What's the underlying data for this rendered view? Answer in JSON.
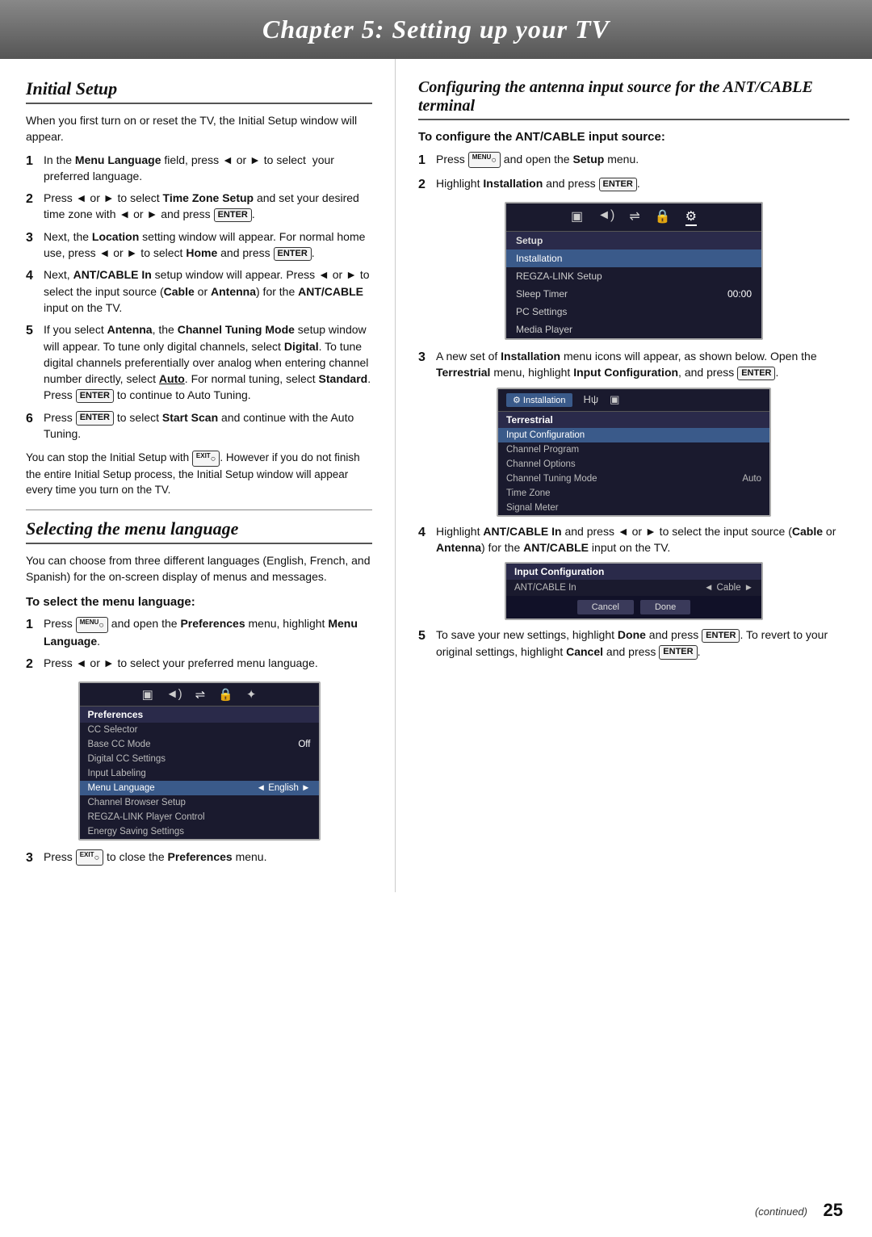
{
  "header": {
    "title": "Chapter 5: Setting up your TV"
  },
  "left": {
    "initial_setup": {
      "title": "Initial Setup",
      "intro": "When you first turn on or reset the TV, the Initial Setup window will appear.",
      "steps": [
        {
          "num": "1",
          "text": "In the ",
          "bold1": "Menu Language",
          "mid1": " field, press ◄ or ► to select  your preferred language."
        },
        {
          "num": "2",
          "text": "Press ◄ or ► to select ",
          "bold1": "Time Zone Setup",
          "mid1": " and set your desired time zone with ◄ or ► and press ",
          "key1": "ENTER"
        },
        {
          "num": "3",
          "text": "Next, the ",
          "bold1": "Location",
          "mid1": " setting window will appear. For normal home use, press ◄ or ► to select ",
          "bold2": "Home",
          "mid2": " and press ",
          "key1": "ENTER"
        },
        {
          "num": "4",
          "text": "Next, ",
          "bold1": "ANT/CABLE In",
          "mid1": " setup window will appear. Press ◄ or ► to select the input source (",
          "bold2": "Cable",
          "mid2": " or ",
          "bold3": "Antenna",
          "mid3": ") for the ",
          "bold4": "ANT/CABLE",
          "mid4": " input on the TV."
        },
        {
          "num": "5",
          "text": "If you select ",
          "bold1": "Antenna",
          "mid1": ", the ",
          "bold2": "Channel Tuning Mode",
          "mid2": " setup window will appear. To tune only digital channels, select ",
          "bold3": "Digital",
          "mid3": ". To tune digital channels preferentially over analog when entering channel number directly, select ",
          "bold4": "Auto",
          "mid4": ". For normal tuning, select ",
          "bold5": "Standard",
          "mid5": ". Press ",
          "key1": "ENTER",
          "mid6": " to continue to Auto Tuning."
        },
        {
          "num": "6",
          "text": "Press ",
          "key1": "ENTER",
          "mid1": " to select ",
          "bold1": "Start Scan",
          "mid2": " and continue with the Auto Tuning."
        }
      ],
      "note": "You can stop the Initial Setup with EXIT. However if you do not finish the entire Initial Setup process, the Initial Setup window will appear every time you turn on the TV."
    },
    "selecting_menu": {
      "title": "Selecting the menu language",
      "intro": "You can choose from three different languages (English, French, and Spanish) for the on-screen display of menus and messages.",
      "subsection": "To select the menu language:",
      "steps": [
        {
          "num": "1",
          "text": "Press ",
          "key1": "MENU",
          "mid1": " and open the ",
          "bold1": "Preferences",
          "mid2": " menu, highlight ",
          "bold2": "Menu Language",
          "mid3": "."
        },
        {
          "num": "2",
          "text": "Press ◄ or ► to select your preferred menu language."
        },
        {
          "num": "3",
          "text": "Press ",
          "key1": "EXIT",
          "mid1": " to close the ",
          "bold1": "Preferences",
          "mid2": " menu."
        }
      ]
    }
  },
  "right": {
    "configuring": {
      "title": "Configuring the antenna input source for the ANT/CABLE terminal",
      "subsection": "To configure the ANT/CABLE input source:",
      "steps": [
        {
          "num": "1",
          "text": "Press ",
          "key1": "MENU",
          "mid1": " and open the ",
          "bold1": "Setup",
          "mid2": " menu."
        },
        {
          "num": "2",
          "text": "Highlight ",
          "bold1": "Installation",
          "mid1": " and press ",
          "key1": "ENTER",
          "mid2": "."
        },
        {
          "num": "3",
          "text": "A new set of ",
          "bold1": "Installation",
          "mid1": " menu icons will appear, as shown below. Open the ",
          "bold2": "Terrestrial",
          "mid2": " menu, highlight ",
          "bold3": "Input Configuration",
          "mid3": ", and press ",
          "key1": "ENTER",
          "mid4": "."
        },
        {
          "num": "4",
          "text": "Highlight ",
          "bold1": "ANT/CABLE In",
          "mid1": " and press ◄ or ► to select the input source (",
          "bold2": "Cable",
          "mid2": " or ",
          "bold3": "Antenna",
          "mid3": ") for the ",
          "bold4": "ANT/CABLE",
          "mid4": " input on the TV."
        },
        {
          "num": "5",
          "text": "To save your new settings, highlight ",
          "bold1": "Done",
          "mid1": " and press ",
          "key1": "ENTER",
          "mid2": ". To revert to your original settings, highlight ",
          "bold2": "Cancel",
          "mid2b": " and press ",
          "key2": "ENTER",
          "mid3": "."
        }
      ]
    }
  },
  "setup_screen": {
    "menu_items": [
      "▣",
      "♪",
      "⇌",
      "🔒",
      "⚙"
    ],
    "active_icon": 4,
    "section": "Setup",
    "rows": [
      {
        "label": "Installation",
        "value": "",
        "highlighted": true
      },
      {
        "label": "REGZA-LINK Setup",
        "value": ""
      },
      {
        "label": "Sleep Timer",
        "value": "00:00"
      },
      {
        "label": "PC Settings",
        "value": ""
      },
      {
        "label": "Media Player",
        "value": ""
      }
    ]
  },
  "installation_screen": {
    "menu_items": [
      "⚙ Installation",
      "Hψ",
      "▣"
    ],
    "section": "Terrestrial",
    "rows": [
      {
        "label": "Input Configuration",
        "value": "",
        "highlighted": true
      },
      {
        "label": "Channel Program",
        "value": ""
      },
      {
        "label": "Channel Options",
        "value": ""
      },
      {
        "label": "Channel Tuning Mode",
        "value": "Auto"
      },
      {
        "label": "Time Zone",
        "value": ""
      },
      {
        "label": "Signal Meter",
        "value": ""
      }
    ]
  },
  "preferences_screen": {
    "section": "Preferences",
    "rows": [
      {
        "label": "CC Selector",
        "value": "",
        "highlighted": false
      },
      {
        "label": "Base CC Mode",
        "value": "Off"
      },
      {
        "label": "Digital CC Settings",
        "value": ""
      },
      {
        "label": "Input Labeling",
        "value": ""
      },
      {
        "label": "Menu Language",
        "value": "English",
        "highlighted": true,
        "has_arrows": true
      },
      {
        "label": "Channel Browser Setup",
        "value": ""
      },
      {
        "label": "REGZA-LINK Player Control",
        "value": ""
      },
      {
        "label": "Energy Saving Settings",
        "value": ""
      }
    ]
  },
  "ant_cable_screen": {
    "header": "Input Configuration",
    "label": "ANT/CABLE In",
    "value": "Cable",
    "buttons": [
      "Cancel",
      "Done"
    ]
  },
  "footer": {
    "page_number": "25",
    "continued": "(continued)"
  }
}
